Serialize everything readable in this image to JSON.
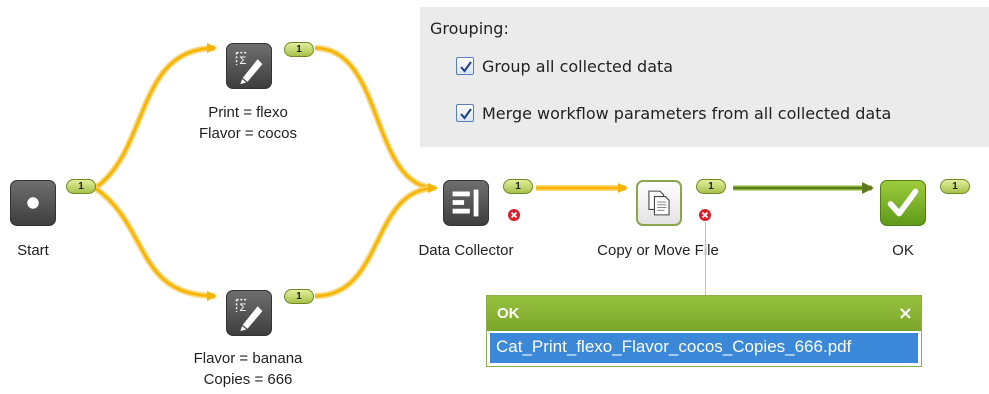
{
  "panel": {
    "title": "Grouping:",
    "options": [
      {
        "label": "Group all collected data",
        "checked": true
      },
      {
        "label": "Merge workflow parameters from all collected data",
        "checked": true
      }
    ]
  },
  "nodes": {
    "start": {
      "label": "Start",
      "count": "1"
    },
    "print_flexo": {
      "label_line1": "Print = flexo",
      "label_line2": "Flavor = cocos",
      "count": "1"
    },
    "flavor_banana": {
      "label_line1": "Flavor = banana",
      "label_line2": "Copies = 666",
      "count": "1"
    },
    "data_collector": {
      "label": "Data Collector",
      "count": "1"
    },
    "copy_move": {
      "label": "Copy or Move File",
      "count": "1"
    },
    "ok": {
      "label": "OK",
      "count": "1"
    }
  },
  "tooltip": {
    "title": "OK",
    "close": "×",
    "file": "Cat_Print_flexo_Flavor_cocos_Copies_666.pdf"
  },
  "colors": {
    "wire_orange": "#f6b400",
    "wire_green": "#6f8a25",
    "accent_green": "#8bb63a",
    "error_red": "#d8202a",
    "selection_blue": "#3b88d8"
  }
}
